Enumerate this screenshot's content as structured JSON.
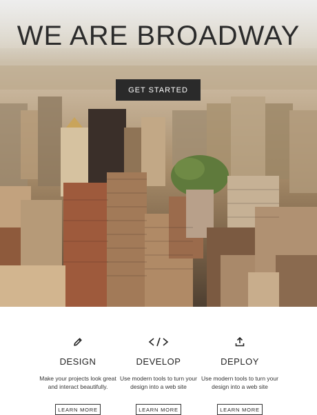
{
  "hero": {
    "title": "WE ARE BROADWAY",
    "cta_label": "GET STARTED"
  },
  "features": [
    {
      "icon": "pencil-icon",
      "title": "DESIGN",
      "text": "Make your projects look great and interact beautifully.",
      "button_label": "LEARN MORE"
    },
    {
      "icon": "code-icon",
      "title": "DEVELOP",
      "text": "Use modern tools to turn your design into a web site",
      "button_label": "LEARN MORE"
    },
    {
      "icon": "upload-icon",
      "title": "DEPLOY",
      "text": "Use modern tools to turn your design into a web site",
      "button_label": "LEARN MORE"
    }
  ],
  "colors": {
    "cta_background": "#2a2a2a",
    "title_text": "#2b2b2b",
    "section_background": "#ffffff"
  }
}
